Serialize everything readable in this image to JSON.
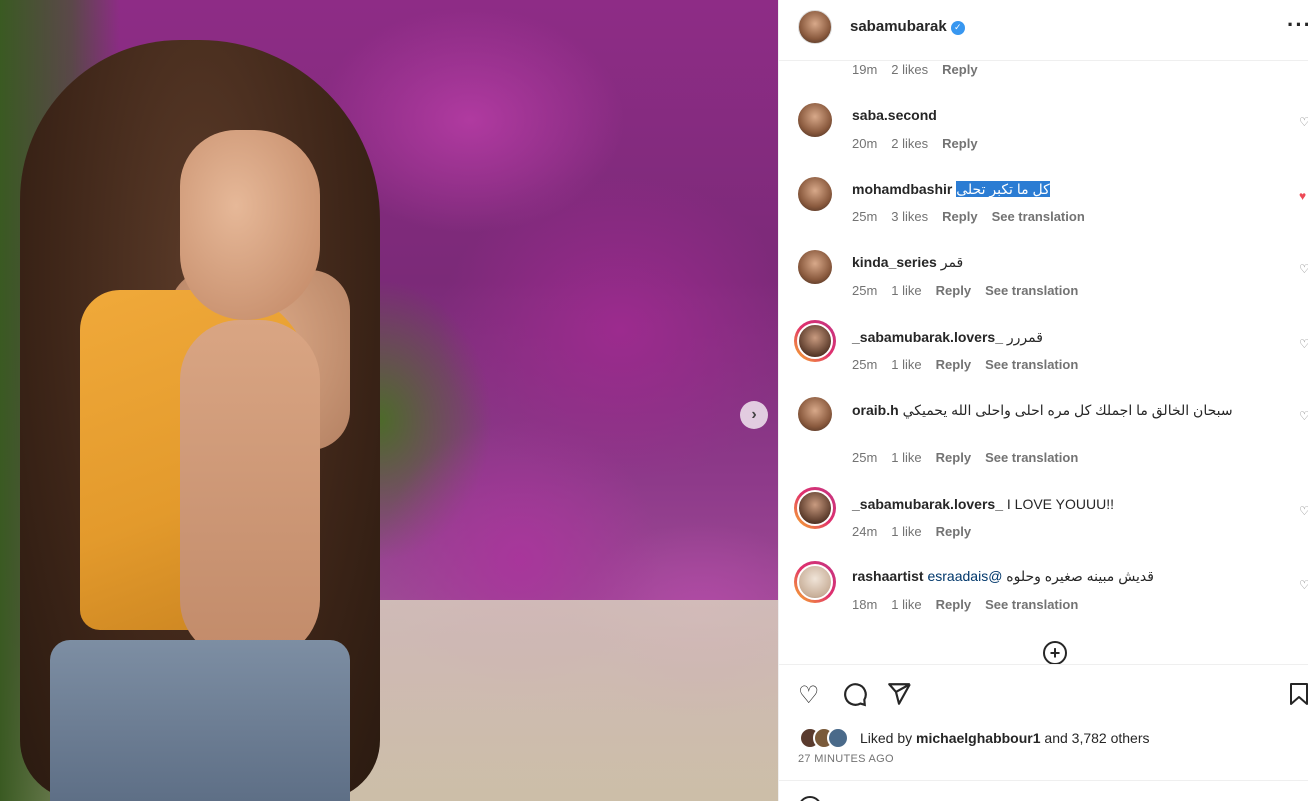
{
  "post": {
    "username": "sabamubarak",
    "verified_icon": "verified-badge-icon"
  },
  "comments": [
    {
      "user": "",
      "text": "",
      "time": "19m",
      "likes": "2 likes",
      "reply": "Reply",
      "translate": ""
    },
    {
      "user": "saba.second",
      "text": "",
      "time": "20m",
      "likes": "2 likes",
      "reply": "Reply",
      "translate": ""
    },
    {
      "user": "mohamdbashir",
      "text": "كل ما تكبر تحلى",
      "time": "25m",
      "likes": "3 likes",
      "reply": "Reply",
      "translate": "See translation"
    },
    {
      "user": "kinda_series",
      "text": "قمر",
      "time": "25m",
      "likes": "1 like",
      "reply": "Reply",
      "translate": "See translation"
    },
    {
      "user": "_sabamubarak.lovers_",
      "text": "قمررر",
      "time": "25m",
      "likes": "1 like",
      "reply": "Reply",
      "translate": "See translation"
    },
    {
      "user": "oraib.h",
      "text": "سبحان الخالق ما اجملك كل مره احلى واحلى الله يحميكي",
      "time": "25m",
      "likes": "1 like",
      "reply": "Reply",
      "translate": "See translation"
    },
    {
      "user": "_sabamubarak.lovers_",
      "text": "I LOVE YOUUU!!",
      "time": "24m",
      "likes": "1 like",
      "reply": "Reply",
      "translate": ""
    },
    {
      "user": "rashaartist",
      "mention": "esraadais@",
      "text": "قديش مبينه صغيره وحلوه",
      "time": "18m",
      "likes": "1 like",
      "reply": "Reply",
      "translate": "See translation"
    }
  ],
  "actions": {
    "liked_by_prefix": "Liked by",
    "liked_by_user": "michaelghabbour1",
    "liked_by_suffix": "and 3,782 others",
    "time_ago": "27 MINUTES AGO"
  },
  "icons": {
    "like": "heart-icon",
    "comment": "comment-icon",
    "share": "share-icon",
    "save": "bookmark-icon",
    "more": "more-options-icon",
    "next": "chevron-right-icon",
    "load_more": "plus-circle-icon"
  },
  "colors": {
    "highlight": "#2b7cd3",
    "verified": "#3897f0",
    "liked_heart": "#ed4956"
  }
}
